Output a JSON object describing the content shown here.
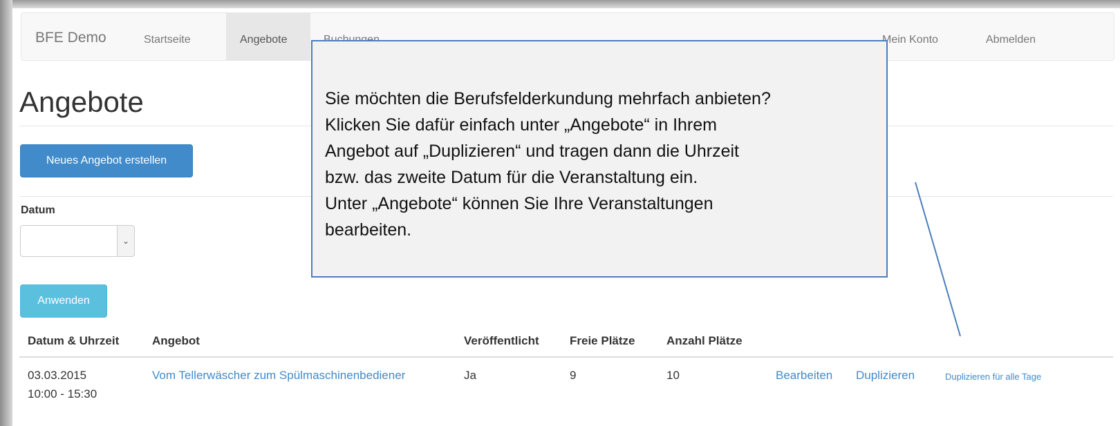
{
  "navbar": {
    "brand": "BFE Demo",
    "items": [
      {
        "label": "Startseite"
      },
      {
        "label": "Angebote",
        "active": true
      },
      {
        "label": "Buchungen"
      }
    ],
    "right_items": [
      {
        "label": "Mein Konto"
      },
      {
        "label": "Abmelden"
      }
    ]
  },
  "page": {
    "title": "Angebote",
    "new_offer_button": "Neues Angebot erstellen",
    "filter": {
      "label": "Datum",
      "selected_value": "",
      "apply_button": "Anwenden"
    }
  },
  "table": {
    "headers": [
      "Datum & Uhrzeit",
      "Angebot",
      "Veröffentlicht",
      "Freie Plätze",
      "Anzahl Plätze"
    ],
    "rows": [
      {
        "date": "03.03.2015",
        "time": "10:00 - 15:30",
        "offer": "Vom Tellerwäscher zum Spülmaschinenbediener",
        "published": "Ja",
        "free": "9",
        "total": "10",
        "action_edit": "Bearbeiten",
        "action_duplicate": "Duplizieren",
        "action_duplicate_all": "Duplizieren für alle Tage"
      }
    ]
  },
  "callout": {
    "text": "Sie möchten die Berufsfelderkundung mehrfach anbieten?\nKlicken Sie dafür einfach unter „Angebote“ in Ihrem\nAngebot auf „Duplizieren“ und tragen dann die Uhrzeit\nbzw. das zweite Datum für die Veranstaltung ein.\nUnter „Angebote“ können Sie Ihre Veranstaltungen\nbearbeiten."
  },
  "colors": {
    "link": "#428bca",
    "primary": "#428bca",
    "info": "#5bc0de",
    "callout_border": "#4a7ebb"
  }
}
